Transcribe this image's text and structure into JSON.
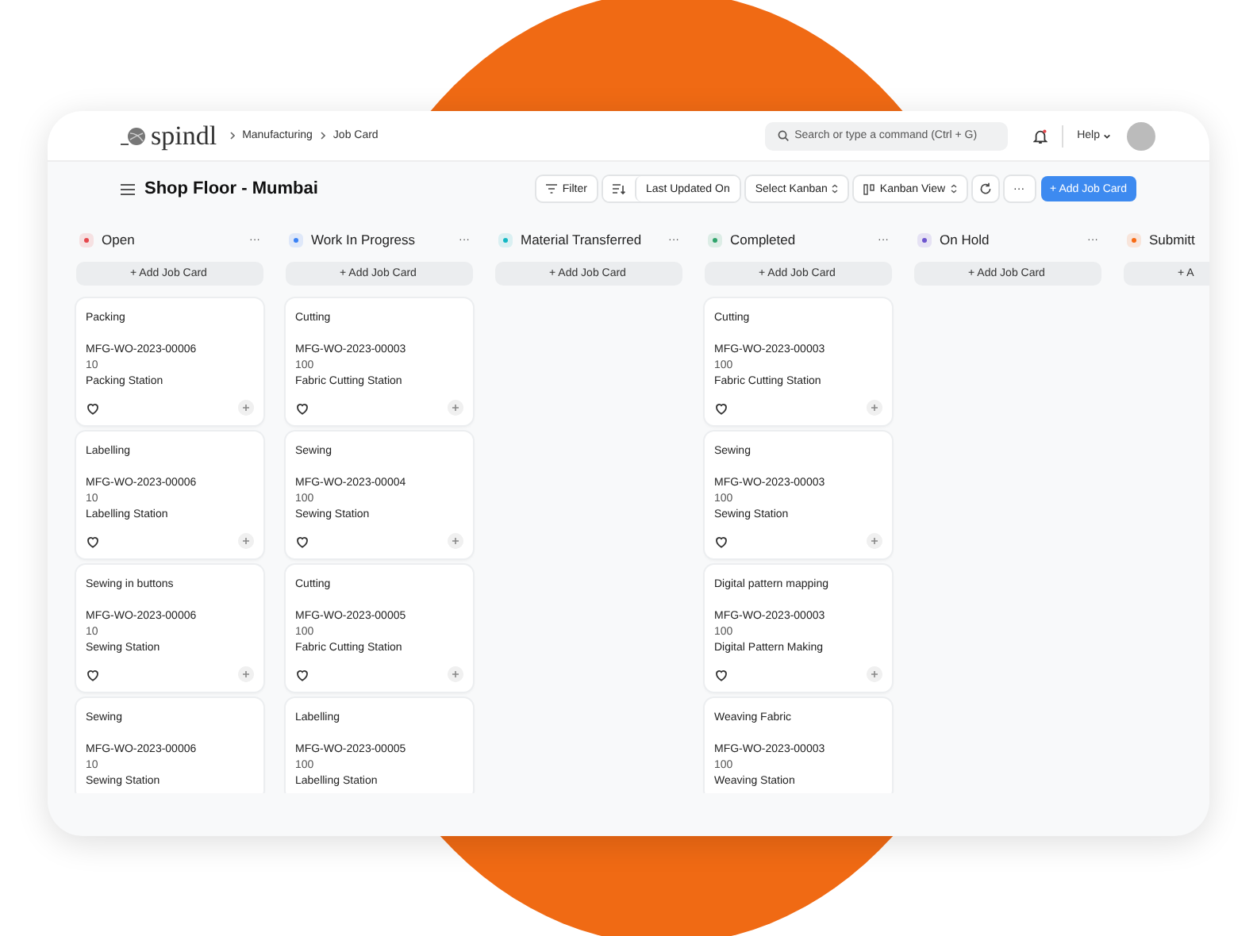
{
  "app": {
    "logo": "spindl",
    "breadcrumbs": [
      "Manufacturing",
      "Job Card"
    ],
    "search": {
      "placeholder": "Search or type a command (Ctrl + G)"
    },
    "help": "Help"
  },
  "page": {
    "title": "Shop Floor - Mumbai",
    "toolbar": {
      "filter": "Filter",
      "sort": "Last Updated On",
      "select_kanban": "Select Kanban",
      "view": "Kanban View",
      "more": "···",
      "primary": "+ Add Job Card"
    }
  },
  "columns": [
    {
      "title": "Open",
      "color": "#e5484d",
      "more": "···",
      "add": "+ Add Job Card",
      "cards": [
        {
          "operation": "Packing",
          "work_order": "MFG-WO-2023-00006",
          "qty": "10",
          "workstation": "Packing Station",
          "footer": true
        },
        {
          "operation": "Labelling",
          "work_order": "MFG-WO-2023-00006",
          "qty": "10",
          "workstation": "Labelling Station",
          "footer": true
        },
        {
          "operation": "Sewing in buttons",
          "work_order": "MFG-WO-2023-00006",
          "qty": "10",
          "workstation": "Sewing Station",
          "footer": true
        },
        {
          "operation": "Sewing",
          "work_order": "MFG-WO-2023-00006",
          "qty": "10",
          "workstation": "Sewing Station",
          "footer": false
        }
      ]
    },
    {
      "title": "Work In Progress",
      "color": "#3b82f6",
      "more": "···",
      "add": "+ Add Job Card",
      "cards": [
        {
          "operation": "Cutting",
          "work_order": "MFG-WO-2023-00003",
          "qty": "100",
          "workstation": "Fabric Cutting Station",
          "footer": true
        },
        {
          "operation": "Sewing",
          "work_order": "MFG-WO-2023-00004",
          "qty": "100",
          "workstation": "Sewing Station",
          "footer": true
        },
        {
          "operation": "Cutting",
          "work_order": "MFG-WO-2023-00005",
          "qty": "100",
          "workstation": "Fabric Cutting Station",
          "footer": true
        },
        {
          "operation": "Labelling",
          "work_order": "MFG-WO-2023-00005",
          "qty": "100",
          "workstation": "Labelling Station",
          "footer": false
        }
      ]
    },
    {
      "title": "Material Transferred",
      "color": "#14b8c4",
      "more": "···",
      "add": "+ Add Job Card"
    },
    {
      "title": "Completed",
      "color": "#30a46c",
      "more": "···",
      "add": "+ Add Job Card",
      "cards": [
        {
          "operation": "Cutting",
          "work_order": "MFG-WO-2023-00003",
          "qty": "100",
          "workstation": "Fabric Cutting Station",
          "footer": true
        },
        {
          "operation": "Sewing",
          "work_order": "MFG-WO-2023-00003",
          "qty": "100",
          "workstation": "Sewing Station",
          "footer": true
        },
        {
          "operation": "Digital pattern mapping",
          "work_order": "MFG-WO-2023-00003",
          "qty": "100",
          "workstation": "Digital Pattern Making",
          "footer": true
        },
        {
          "operation": "Weaving Fabric",
          "work_order": "MFG-WO-2023-00003",
          "qty": "100",
          "workstation": "Weaving Station",
          "footer": false
        }
      ]
    },
    {
      "title": "On Hold",
      "color": "#6e56cf",
      "more": "···",
      "add": "+ Add Job Card"
    },
    {
      "title": "Submitt",
      "color": "#f76b15",
      "add": "+ A"
    }
  ]
}
